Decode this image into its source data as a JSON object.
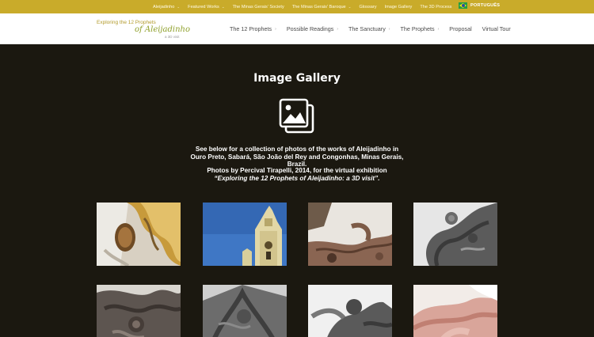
{
  "topbar": {
    "items": [
      {
        "label": "Aleijadinho",
        "has_dropdown": true
      },
      {
        "label": "Featured Works",
        "has_dropdown": true
      },
      {
        "label": "The Minas Gerais' Society",
        "has_dropdown": false
      },
      {
        "label": "The Minas Gerais' Baroque",
        "has_dropdown": true
      },
      {
        "label": "Glossary",
        "has_dropdown": false
      },
      {
        "label": "Image Gallery",
        "has_dropdown": false
      },
      {
        "label": "The 3D Process",
        "has_dropdown": false
      }
    ],
    "language": "PORTUGUÊS",
    "caret": "⌄"
  },
  "logo": {
    "line1": "Exploring the 12 Prophets",
    "line2": "of Aleijadinho",
    "line3": "a 3D visit"
  },
  "mainnav": {
    "items": [
      {
        "label": "The 12 Prophets",
        "has_dropdown": true
      },
      {
        "label": "Possible Readings",
        "has_dropdown": true
      },
      {
        "label": "The Sanctuary",
        "has_dropdown": true
      },
      {
        "label": "The Prophets",
        "has_dropdown": true
      },
      {
        "label": "Proposal",
        "has_dropdown": false
      },
      {
        "label": "Virtual Tour",
        "has_dropdown": false
      }
    ],
    "caret": "›"
  },
  "page": {
    "title": "Image Gallery",
    "icon": "images-icon",
    "intro": "See below for a collection of photos of the works of Aleijadinho in Ouro Preto, Sabará, São João del Rey and Congonhas, Minas Gerais, Brazil.",
    "credit_line": "Photos by Percival Tirapelli, 2014, for the virtual exhibition",
    "credit_title": "“Exploring the 12 Prophets of Aleijadinho: a 3D visit”."
  },
  "gallery": {
    "thumbnails": [
      {
        "name": "gallery-photo-1"
      },
      {
        "name": "gallery-photo-2"
      },
      {
        "name": "gallery-photo-3"
      },
      {
        "name": "gallery-photo-4"
      },
      {
        "name": "gallery-photo-5"
      },
      {
        "name": "gallery-photo-6"
      },
      {
        "name": "gallery-photo-7"
      },
      {
        "name": "gallery-photo-8"
      }
    ]
  },
  "colors": {
    "topbar": "#c9ab2a",
    "background": "#1b1810",
    "header": "#ffffff",
    "logo_green": "#8fa02b"
  }
}
